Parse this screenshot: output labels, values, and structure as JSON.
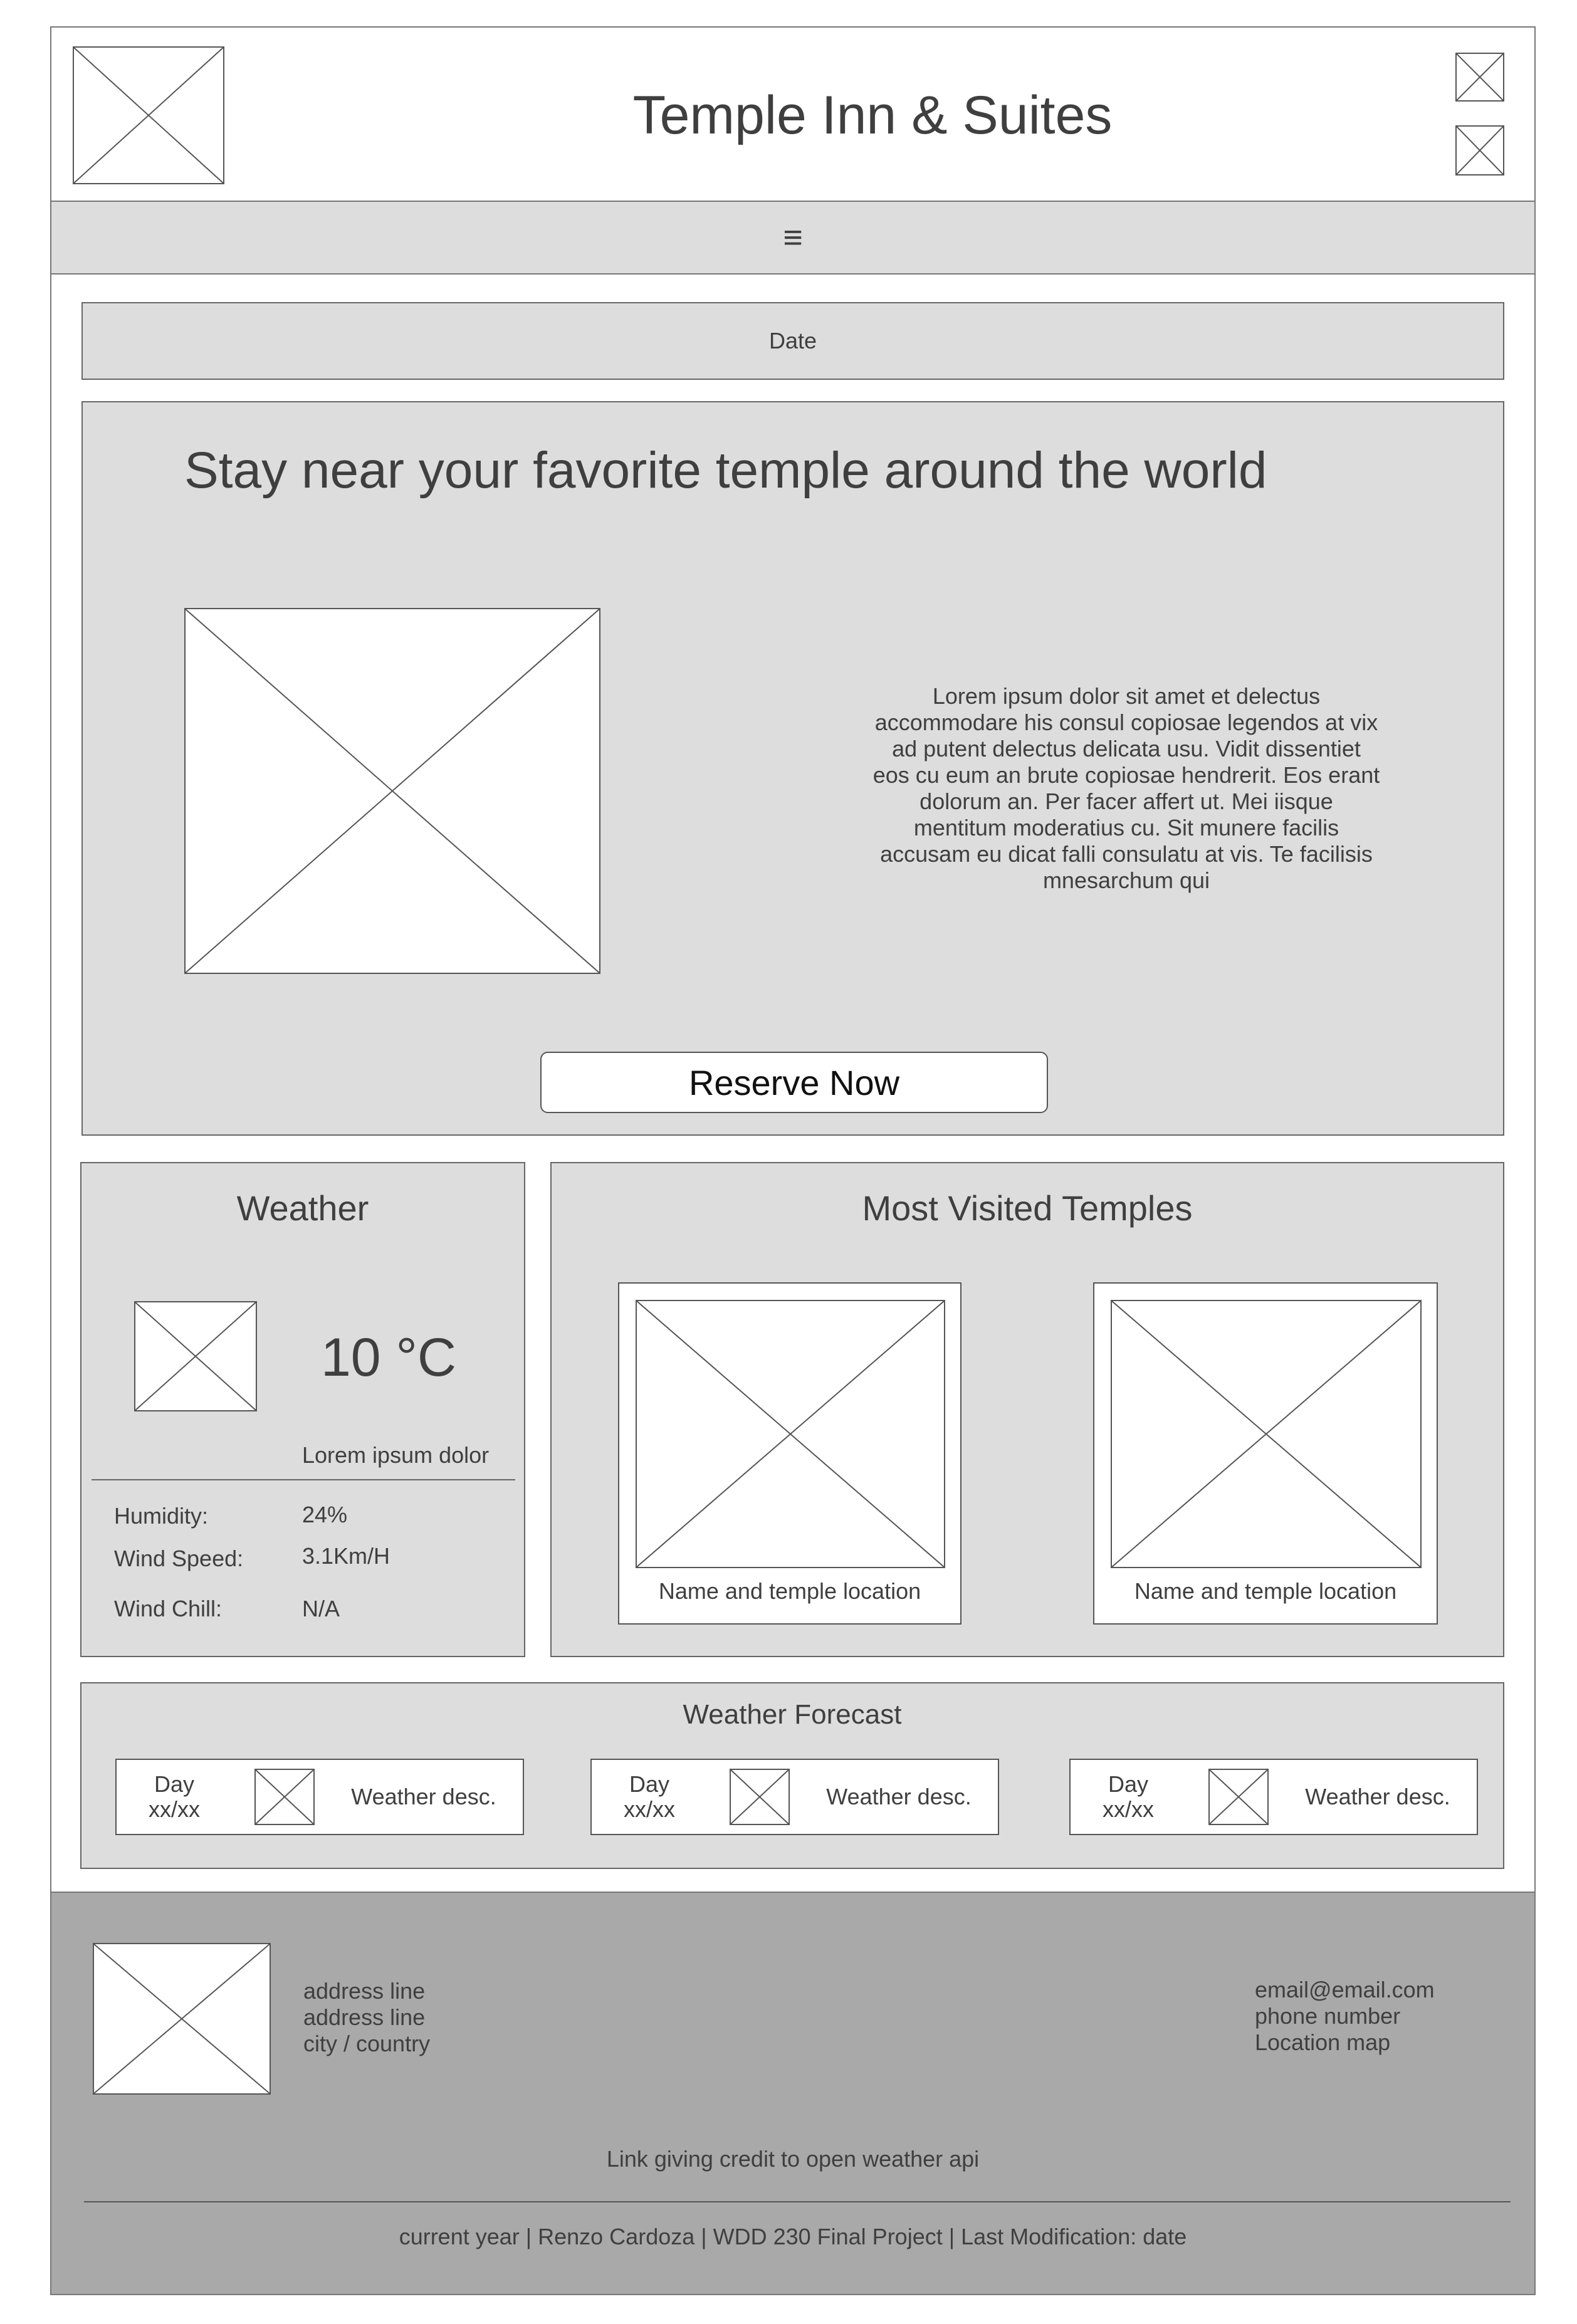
{
  "header": {
    "title": "Temple Inn & Suites",
    "menu_icon_glyph": "≡"
  },
  "date_bar": {
    "label": "Date"
  },
  "hero": {
    "heading": "Stay near your favorite temple around the world",
    "paragraph": "Lorem ipsum dolor sit amet et delectus accommodare his consul copiosae legendos at vix ad putent delectus delicata usu. Vidit dissentiet eos cu eum an brute copiosae hendrerit. Eos erant dolorum an. Per facer affert ut. Mei iisque mentitum moderatius cu. Sit munere facilis accusam eu dicat falli consulatu at vis. Te facilisis mnesarchum qui",
    "button_label": "Reserve Now"
  },
  "weather": {
    "title": "Weather",
    "temperature": "10 °C",
    "description": "Lorem ipsum dolor",
    "rows": [
      {
        "label": "Humidity:",
        "value": "24%"
      },
      {
        "label": "Wind Speed:",
        "value": "3.1Km/H"
      },
      {
        "label": "Wind Chill:",
        "value": "N/A"
      }
    ]
  },
  "temples": {
    "title": "Most Visited Temples",
    "cards": [
      {
        "caption": "Name and temple location"
      },
      {
        "caption": "Name and temple location"
      }
    ]
  },
  "forecast": {
    "title": "Weather Forecast",
    "days": [
      {
        "day": "Day",
        "date": "xx/xx",
        "desc": "Weather desc."
      },
      {
        "day": "Day",
        "date": "xx/xx",
        "desc": "Weather desc."
      },
      {
        "day": "Day",
        "date": "xx/xx",
        "desc": "Weather desc."
      }
    ]
  },
  "footer": {
    "address": [
      "address line",
      "address line",
      "city / country"
    ],
    "contact": [
      "email@email.com",
      "phone number",
      "Location map"
    ],
    "credit_link": "Link giving credit to open weather api",
    "bottom_line": "current year | Renzo Cardoza | WDD 230 Final Project | Last Modification: date"
  },
  "colors": {
    "section_gray": "#dddddd",
    "footer_gray": "#a9a9a9",
    "text": "#3f3f3f",
    "outline": "#555555"
  }
}
